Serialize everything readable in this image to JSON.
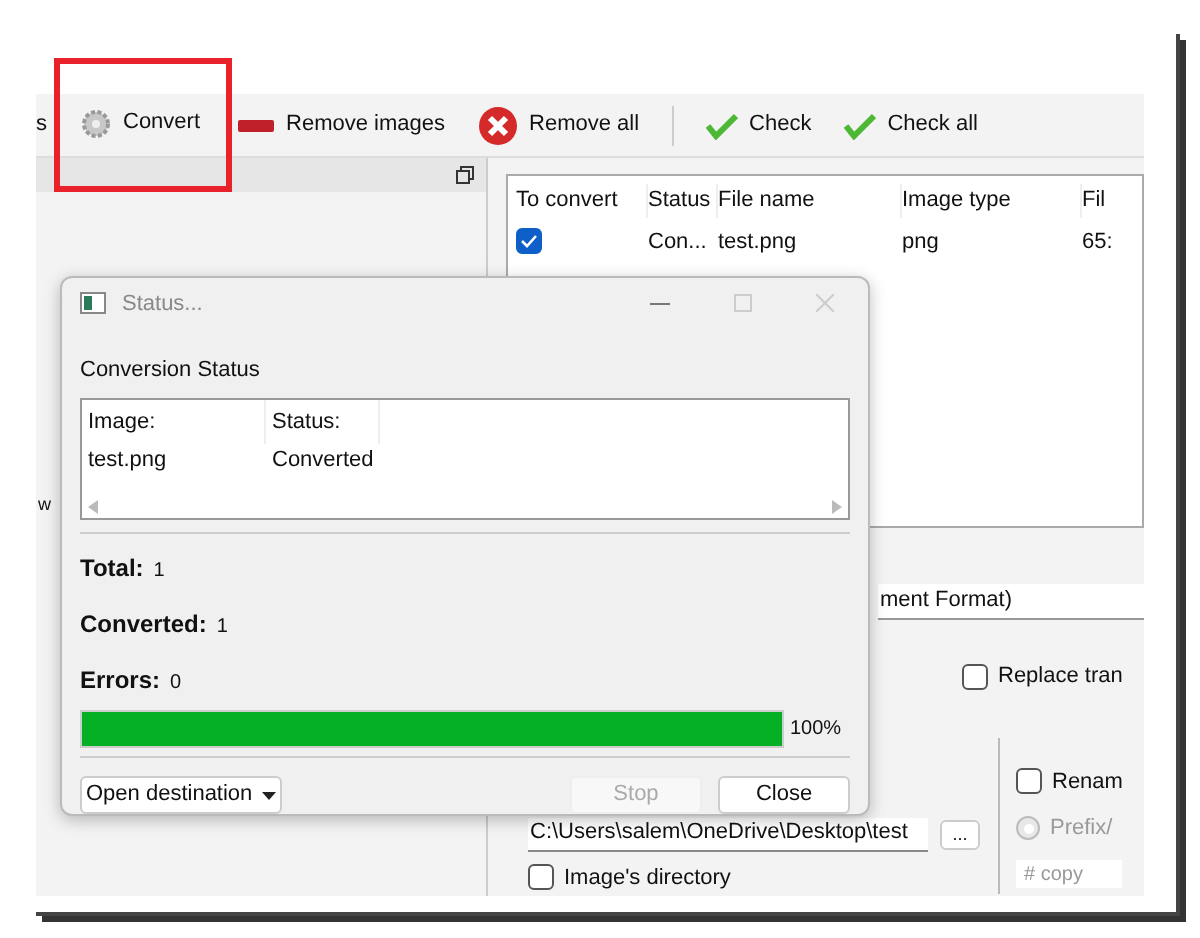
{
  "toolbar": {
    "items": [
      {
        "label": "s",
        "highlighted": false
      },
      {
        "label": "Convert",
        "highlighted": true
      },
      {
        "label": "Remove images",
        "highlighted": false
      },
      {
        "label": "Remove all",
        "highlighted": false
      },
      {
        "label": "Check",
        "highlighted": false
      },
      {
        "label": "Check all",
        "highlighted": false
      }
    ]
  },
  "left_panel": {
    "label": "w"
  },
  "file_table": {
    "columns": [
      "To convert",
      "Status",
      "File name",
      "Image type",
      "Fil"
    ],
    "rows": [
      {
        "checked": true,
        "status": "Con...",
        "file_name": "test.png",
        "image_type": "png",
        "column_5": "65:"
      }
    ]
  },
  "format_field": {
    "value": "ment Format)"
  },
  "replace_checkbox": {
    "label": "Replace tran",
    "checked": false
  },
  "output": {
    "path": "C:\\Users\\salem\\OneDrive\\Desktop\\test",
    "browse_label": "...",
    "images_directory": {
      "label": "Image's directory",
      "checked": false
    }
  },
  "rename": {
    "label": "Renam",
    "checked": false,
    "prefix_label": "Prefix/",
    "prefix_selected": false,
    "pattern": "# copy"
  },
  "dialog": {
    "title": "Status...",
    "section": "Conversion Status",
    "list_columns": [
      "Image:",
      "Status:"
    ],
    "list_rows": [
      {
        "image": "test.png",
        "status": "Converted"
      }
    ],
    "stats": [
      {
        "label": "Total:",
        "value": "1"
      },
      {
        "label": "Converted:",
        "value": "1"
      },
      {
        "label": "Errors:",
        "value": "0"
      }
    ],
    "progress": {
      "level": 1,
      "reading": "100%"
    },
    "open_destination": "Open destination",
    "stop": {
      "label": "Stop",
      "disabled": true
    },
    "close": {
      "label": "Close",
      "disabled": false
    }
  }
}
